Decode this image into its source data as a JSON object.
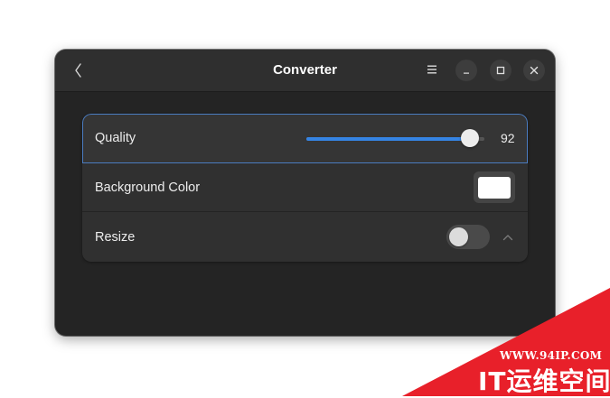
{
  "window": {
    "title": "Converter",
    "icons": {
      "back": "chevron-left-icon",
      "menu": "hamburger-menu-icon",
      "minimize": "minimize-icon",
      "maximize": "maximize-icon",
      "close": "close-icon"
    }
  },
  "settings": {
    "quality": {
      "label": "Quality",
      "value": "92",
      "fraction": 0.92
    },
    "background_color": {
      "label": "Background Color",
      "color": "#ffffff"
    },
    "resize": {
      "label": "Resize",
      "enabled": false,
      "expander_icon": "chevron-up-icon"
    }
  },
  "colors": {
    "accent": "#3584e4",
    "window_bg": "#242424",
    "watermark": "#e8202a"
  },
  "watermark": {
    "url": "WWW.94IP.COM",
    "brand": "IT运维空间"
  }
}
